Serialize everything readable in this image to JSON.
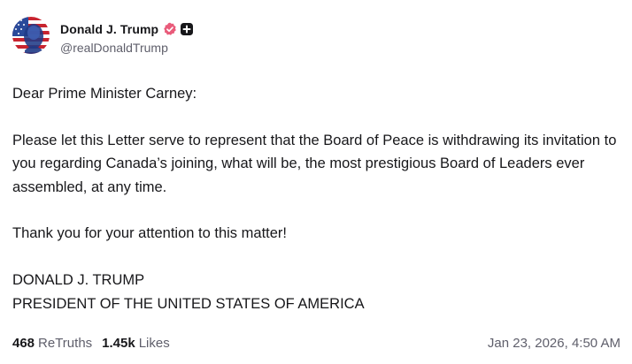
{
  "post": {
    "author": {
      "display_name": "Donald J. Trump",
      "handle": "@realDonaldTrump",
      "avatar_icon": "avatar-flag-portrait",
      "verified_color": "#e95b7a"
    },
    "body": {
      "greeting": "Dear Prime Minister Carney:",
      "paragraph_1": "Please let this Letter serve to represent that the Board of Peace is withdrawing its invitation to you regarding Canada’s joining, what will be, the most prestigious Board of Leaders ever assembled, at any time.",
      "paragraph_2": "Thank you for your attention to this matter!",
      "signature_name": "DONALD J. TRUMP",
      "signature_title": "PRESIDENT OF THE UNITED STATES OF AMERICA"
    },
    "stats": {
      "retruths_count": "468",
      "retruths_label": "ReTruths",
      "likes_count": "1.45k",
      "likes_label": "Likes"
    },
    "timestamp": "Jan 23, 2026, 4:50 AM"
  }
}
